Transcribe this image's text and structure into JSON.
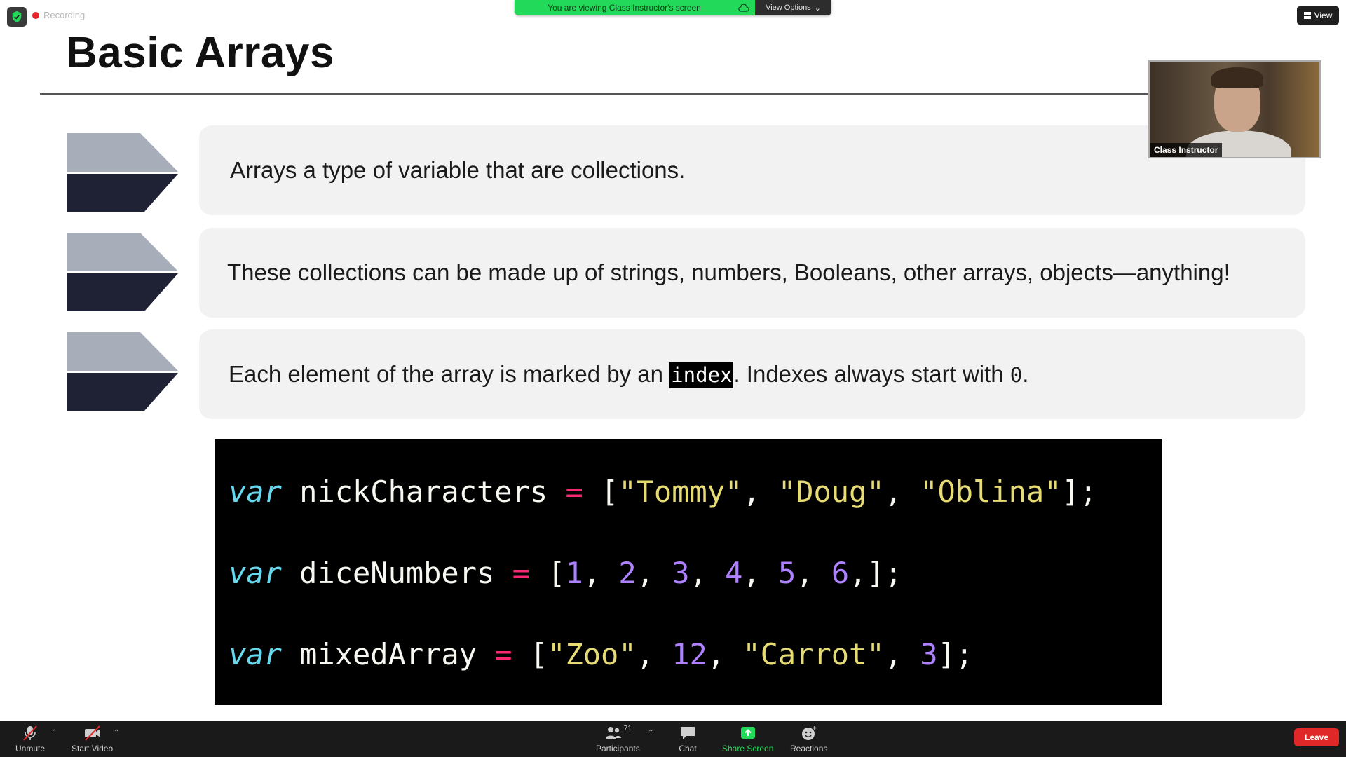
{
  "overlay": {
    "recording_label": "Recording",
    "viewing_message": "You are viewing Class Instructor's screen",
    "view_options_label": "View Options",
    "view_button_label": "View"
  },
  "slide": {
    "title": "Basic Arrays",
    "bullets": [
      {
        "text": "Arrays a type of variable that are collections."
      },
      {
        "text": "These collections can be made up of strings, numbers, Booleans, other arrays, objects—anything!"
      },
      {
        "text_before": "Each element of the array is marked by an ",
        "code": "index",
        "text_middle": ". Indexes always start with ",
        "code2": "0",
        "text_after": "."
      }
    ],
    "code": {
      "line1": {
        "kw": "var",
        "name": " nickCharacters ",
        "op": "=",
        "open": " [",
        "s1": "\"Tommy\"",
        "c1": ", ",
        "s2": "\"Doug\"",
        "c2": ", ",
        "s3": "\"Oblina\"",
        "close": "];"
      },
      "line2": {
        "kw": "var",
        "name": " diceNumbers ",
        "op": "=",
        "open": " [",
        "n1": "1",
        "n2": "2",
        "n3": "3",
        "n4": "4",
        "n5": "5",
        "n6": "6",
        "sep": ", ",
        "close": ",];"
      },
      "line3": {
        "kw": "var",
        "name": " mixedArray ",
        "op": "=",
        "open": " [",
        "s1": "\"Zoo\"",
        "c1": ", ",
        "n1": "12",
        "c2": ", ",
        "s2": "\"Carrot\"",
        "c3": ", ",
        "n2": "3",
        "close": "];"
      }
    }
  },
  "video": {
    "name": "Class Instructor"
  },
  "toolbar": {
    "unmute": "Unmute",
    "start_video": "Start Video",
    "participants": "Participants",
    "participants_count": "71",
    "chat": "Chat",
    "share_screen": "Share Screen",
    "reactions": "Reactions",
    "leave": "Leave"
  },
  "colors": {
    "keyword": "#66d9ef",
    "operator": "#f92672",
    "string": "#e6db74",
    "number": "#ae81ff",
    "share_green": "#23d959",
    "leave_red": "#e02828"
  }
}
